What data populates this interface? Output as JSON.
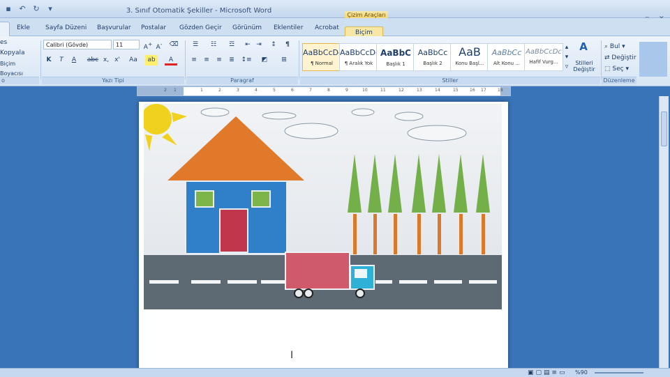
{
  "window": {
    "title": "3. Sınıf Otomatik Şekiller - Microsoft Word",
    "contextual_title": "Çizim Araçları"
  },
  "tabs": [
    "Ekle",
    "Sayfa Düzeni",
    "Başvurular",
    "Postalar",
    "Gözden Geçir",
    "Görünüm",
    "Eklentiler",
    "Acrobat",
    "Biçim"
  ],
  "clipboard": {
    "copy": "Kopyala",
    "format_painter": "Biçim Boyacısı",
    "paste_partial": "es",
    "label_partial": "o"
  },
  "font": {
    "name": "Calibri (Gövde)",
    "size": "11",
    "label": "Yazı Tipi"
  },
  "paragraph": {
    "label": "Paragraf"
  },
  "styles": {
    "label": "Stiller",
    "items": [
      {
        "sample": "AaBbCcDc",
        "name": "¶ Normal"
      },
      {
        "sample": "AaBbCcDc",
        "name": "¶ Aralık Yok"
      },
      {
        "sample": "AaBbC",
        "name": "Başlık 1"
      },
      {
        "sample": "AaBbCc",
        "name": "Başlık 2"
      },
      {
        "sample": "AaB",
        "name": "Konu Başl..."
      },
      {
        "sample": "AaBbCc",
        "name": "Alt Konu ..."
      },
      {
        "sample": "AaBbCcDc",
        "name": "Hafif Vurg..."
      }
    ],
    "change": "Stilleri Değiştir"
  },
  "editing": {
    "label": "Düzenleme",
    "find": "Bul",
    "replace": "Değiştir",
    "select": "Seç"
  },
  "ruler": {
    "ticks": [
      "2",
      "1",
      "1",
      "2",
      "3",
      "4",
      "5",
      "6",
      "7",
      "8",
      "9",
      "10",
      "11",
      "12",
      "13",
      "14",
      "15",
      "16",
      "17",
      "18"
    ]
  },
  "status": {
    "zoom": "%90"
  },
  "colors": {
    "house_roof": "#e07a2a",
    "house_body": "#2f7fc9",
    "door": "#c0364c",
    "window": "#7db54a",
    "tree": "#74b04a",
    "trunk": "#d87a2a",
    "truck_cargo": "#cf5a6c",
    "truck_cab": "#2fb0d6",
    "road": "#5d6a73",
    "sun": "#f0d21e"
  },
  "icons": [
    "undo-icon",
    "redo-icon",
    "bold-icon",
    "italic-icon",
    "underline-icon",
    "font-color-icon",
    "bullets-icon",
    "numbering-icon",
    "align-left-icon",
    "align-center-icon",
    "align-right-icon",
    "justify-icon",
    "pilcrow-icon",
    "find-icon",
    "replace-icon",
    "select-icon",
    "change-styles-icon"
  ]
}
